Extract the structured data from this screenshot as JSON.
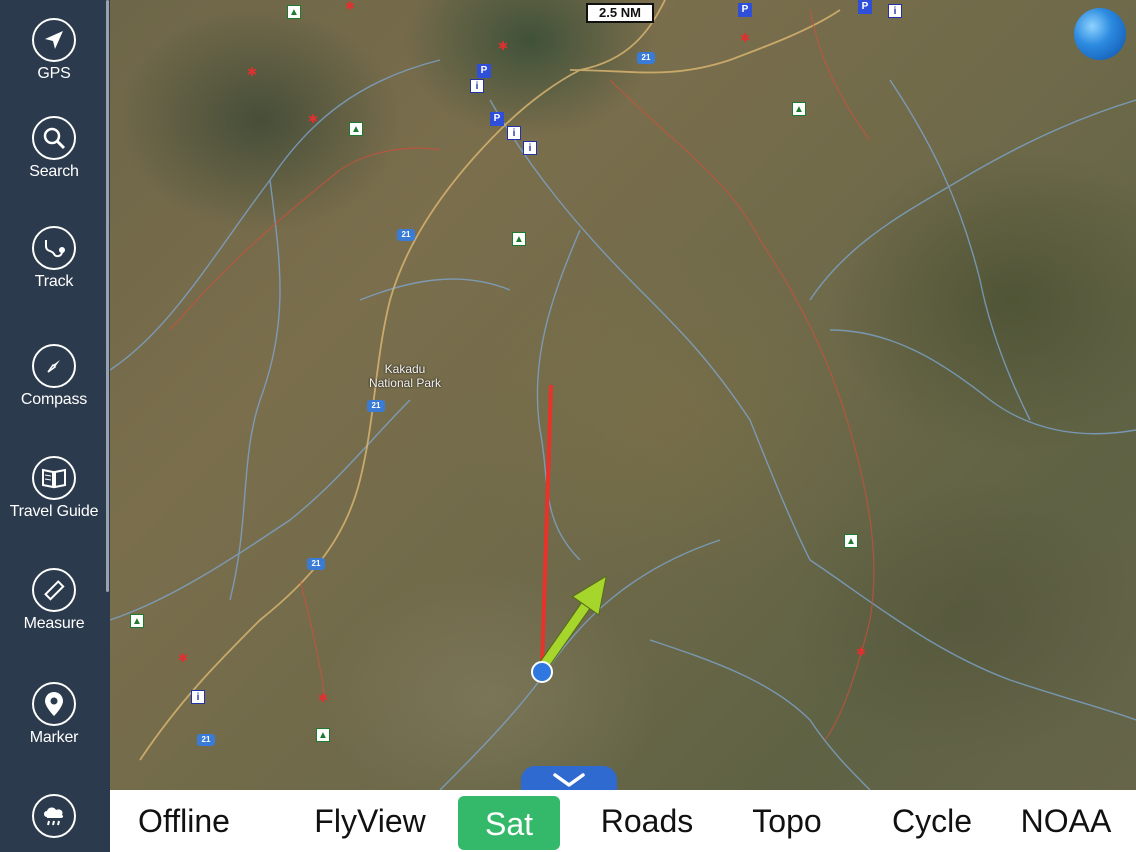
{
  "sidebar": {
    "items": [
      {
        "label": "GPS",
        "icon": "navigation-arrow-icon"
      },
      {
        "label": "Search",
        "icon": "magnifier-icon"
      },
      {
        "label": "Track",
        "icon": "track-icon"
      },
      {
        "label": "Compass",
        "icon": "compass-icon"
      },
      {
        "label": "Travel Guide",
        "icon": "book-icon"
      },
      {
        "label": "Measure",
        "icon": "ruler-icon"
      },
      {
        "label": "Marker",
        "icon": "map-pin-icon"
      },
      {
        "label": "",
        "icon": "weather-cloud-icon"
      }
    ]
  },
  "map": {
    "scale_label": "2.5 NM",
    "park_label_line1": "Kakadu",
    "park_label_line2": "National Park",
    "highway_label": "21",
    "info_marker": "i",
    "parking_marker": "P",
    "colors": {
      "route_line": "#e8322a",
      "heading_arrow": "#a6d52c",
      "river": "#7fa9d6",
      "road": "#d8b470",
      "trail": "#d0503a"
    }
  },
  "bottombar": {
    "tabs": [
      {
        "label": "Offline",
        "active": false
      },
      {
        "label": "FlyView",
        "active": false
      },
      {
        "label": "Sat",
        "active": true
      },
      {
        "label": "Roads",
        "active": false
      },
      {
        "label": "Topo",
        "active": false
      },
      {
        "label": "Cycle",
        "active": false
      },
      {
        "label": "NOAA",
        "active": false
      }
    ],
    "active_color": "#34b96a"
  }
}
